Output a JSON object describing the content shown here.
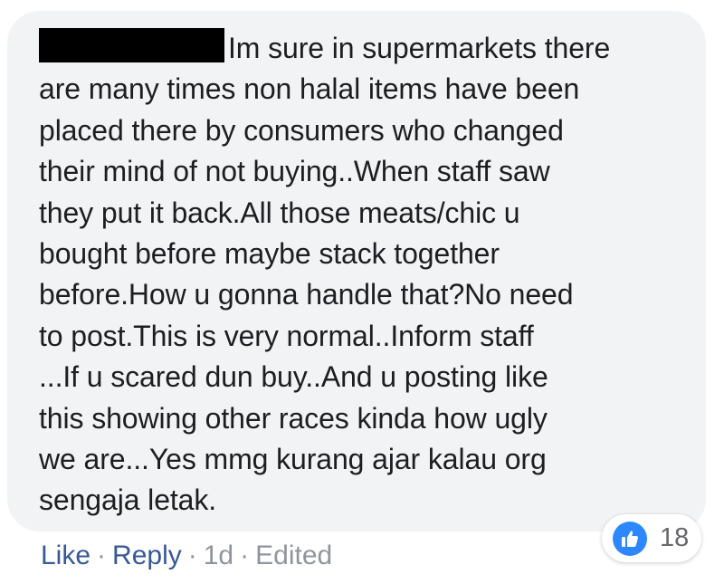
{
  "comment": {
    "lines": [
      "Im sure in supermarkets there",
      "are many times non halal items have been",
      "placed there by consumers who changed",
      "their mind of not buying..When staff saw",
      "they put it back.All those meats/chic u",
      "bought before maybe stack together",
      "before.How u gonna handle that?No need",
      "to post.This is very normal..Inform staff",
      "...If u scared dun buy..And u posting like",
      "this showing other races kinda how ugly",
      "we are...Yes mmg kurang ajar kalau org",
      "sengaja letak."
    ]
  },
  "reactions": {
    "icon": "thumbs-up-icon",
    "count": "18",
    "color": "#2d88ff"
  },
  "actions": {
    "like_label": "Like",
    "reply_label": "Reply",
    "separator": "·",
    "time": "1d",
    "edited_label": "Edited"
  },
  "colors": {
    "bubble": "#f2f3f5",
    "text": "#1c1e21",
    "link": "#385898",
    "meta": "#90949c"
  }
}
